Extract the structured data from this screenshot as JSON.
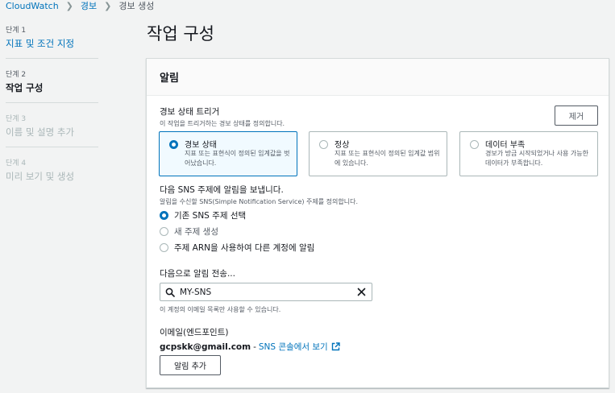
{
  "breadcrumb": {
    "items": [
      "CloudWatch",
      "경보",
      "경보 생성"
    ]
  },
  "steps": [
    {
      "num": "단계 1",
      "label": "지표 및 조건 지정"
    },
    {
      "num": "단계 2",
      "label": "작업 구성"
    },
    {
      "num": "단계 3",
      "label": "이름 및 설명 추가"
    },
    {
      "num": "단계 4",
      "label": "미리 보기 및 생성"
    }
  ],
  "page_title": "작업 구성",
  "panel": {
    "title": "알림",
    "trigger": {
      "label": "경보 상태 트리거",
      "description": "이 작업을 트리거하는 경보 상태를 정의합니다.",
      "remove_label": "제거",
      "options": [
        {
          "label": "경보 상태",
          "description": "지표 또는 표현식이 정의된 임계값을 벗어났습니다.",
          "selected": true
        },
        {
          "label": "정상",
          "description": "지표 또는 표현식이 정의된 임계값 범위에 있습니다.",
          "selected": false
        },
        {
          "label": "데이터 부족",
          "description": "경보가 방금 시작되었거나 사용 가능한 데이터가 부족합니다.",
          "selected": false
        }
      ]
    },
    "sns": {
      "label": "다음 SNS 주제에 알림을 보냅니다.",
      "description": "알림을 수신할 SNS(Simple Notification Service) 주제를 정의합니다.",
      "options": [
        {
          "label": "기존 SNS 주제 선택",
          "selected": true
        },
        {
          "label": "새 주제 생성",
          "selected": false
        },
        {
          "label": "주제 ARN을 사용하여 다른 계정에 알림",
          "selected": false
        }
      ]
    },
    "send_to": {
      "label": "다음으로 알림 전송...",
      "value": "MY-SNS",
      "hint": "이 계정의 이메일 목록만 사용할 수 있습니다."
    },
    "endpoint": {
      "label": "이메일(엔드포인트)",
      "email": "gcpskk@gmail.com",
      "separator": "-",
      "console_link": "SNS 콘솔에서 보기"
    },
    "add_notification_label": "알림 추가"
  },
  "colors": {
    "accent": "#0073bb",
    "text": "#16191f",
    "muted": "#545b64",
    "disabled": "#aab7b8"
  }
}
